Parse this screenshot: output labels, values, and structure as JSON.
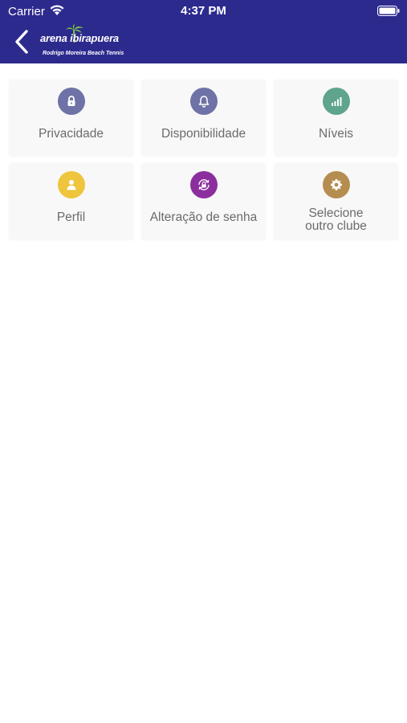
{
  "status_bar": {
    "carrier": "Carrier",
    "time": "4:37 PM"
  },
  "header": {
    "logo_text": "arena ibirapuera",
    "logo_sub": "Rodrigo Moreira Beach Tennis",
    "back_icon": "chevron-left-icon",
    "background_color": "#2d2a8e"
  },
  "menu": {
    "items": [
      {
        "label": "Privacidade",
        "icon": "lock-icon",
        "color": "#6e72a6"
      },
      {
        "label": "Disponibilidade",
        "icon": "bell-icon",
        "color": "#6e72a6"
      },
      {
        "label": "Níveis",
        "icon": "signal-bars-icon",
        "color": "#5fa48c"
      },
      {
        "label": "Perfil",
        "icon": "user-icon",
        "color": "#eec53c"
      },
      {
        "label": "Alteração de senha",
        "icon": "lock-rotate-icon",
        "color": "#8c2f9e"
      },
      {
        "label": "Selecione\noutro clube",
        "icon": "gear-icon",
        "color": "#b68d50"
      }
    ]
  }
}
